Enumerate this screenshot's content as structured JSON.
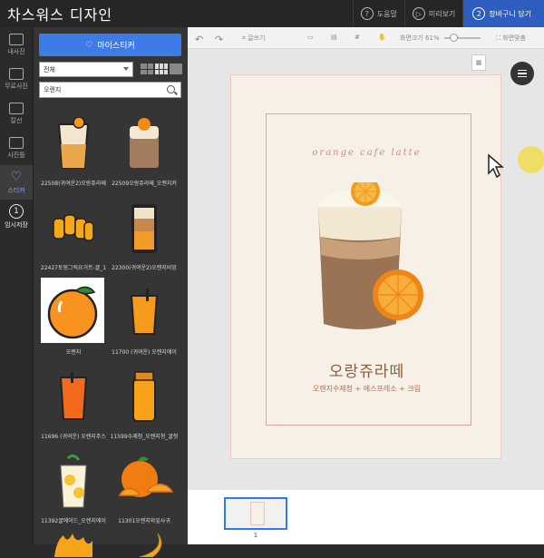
{
  "app": {
    "title": "차스워스 디자인"
  },
  "topbar": {
    "help": "도움말",
    "preview": "미리보기",
    "cart": "장바구니 담기",
    "cart_num": "2"
  },
  "rail": [
    {
      "label": "내사진"
    },
    {
      "label": "무료사진"
    },
    {
      "label": "칼선"
    },
    {
      "label": "사진틀"
    },
    {
      "label": "스티커"
    },
    {
      "label": "임시저장",
      "num": "1"
    }
  ],
  "panel": {
    "mysticker_label": "마이스티커",
    "filter_value": "전체",
    "search_value": "오렌지",
    "items": [
      {
        "caption": "22508(귀여운2)오랑쥬라떼"
      },
      {
        "caption": "22509오랑쥬라떼_오렌지커"
      },
      {
        "caption": "22427토핑그릭요거트-귤_1"
      },
      {
        "caption": "22300(귀여운2)오렌지비앙"
      },
      {
        "caption": "오렌지"
      },
      {
        "caption": "11700 (귀여운) 오렌지에이"
      },
      {
        "caption": "11696 (귀여운) 오렌지주스"
      },
      {
        "caption": "11599수제청_오렌지청_귤청"
      },
      {
        "caption": "11392귤에이드_오렌지에이"
      },
      {
        "caption": "11301오렌지와잎사귀"
      }
    ]
  },
  "toolbar": {
    "text": "글쓰기",
    "zoom_label": "화면크기 61%",
    "fit": "화면맞춤",
    "zoom_value": 0.61
  },
  "canvas": {
    "english_title": "orange cafe latte",
    "title": "오랑쥬라떼",
    "subtitle": "오렌지수제청 + 에스프레소 + 크림"
  },
  "pages": {
    "current": "1"
  },
  "colors": {
    "accent": "#2d5dbf",
    "panel": "#353535",
    "sticker_button": "#3d7ce6"
  }
}
